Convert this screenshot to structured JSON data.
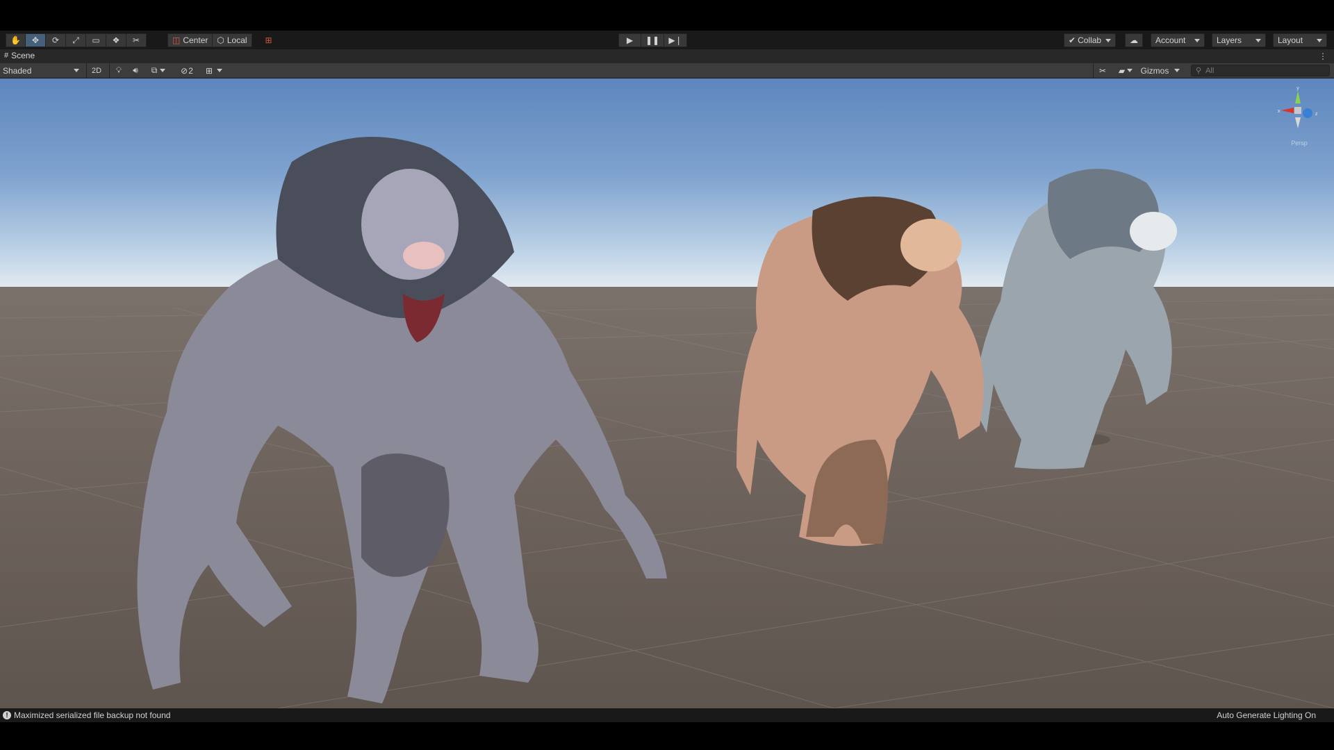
{
  "toolbar": {
    "tools": [
      {
        "icon": "hand-tool-icon",
        "glyph": "✋"
      },
      {
        "icon": "move-tool-icon",
        "glyph": "✥"
      },
      {
        "icon": "rotate-tool-icon",
        "glyph": "⟳"
      },
      {
        "icon": "scale-tool-icon",
        "glyph": "⤢"
      },
      {
        "icon": "rect-tool-icon",
        "glyph": "▭"
      },
      {
        "icon": "transform-tool-icon",
        "glyph": "❖"
      },
      {
        "icon": "custom-tool-icon",
        "glyph": "✂"
      }
    ],
    "pivot_label": "Center",
    "space_label": "Local",
    "collab_label": "Collab",
    "account_label": "Account",
    "layers_label": "Layers",
    "layout_label": "Layout"
  },
  "scene_tab": {
    "title": "Scene"
  },
  "scene_toolbar": {
    "shading_mode": "Shaded",
    "mode_2d": "2D",
    "hidden_count": "2",
    "gizmos_label": "Gizmos",
    "search_placeholder": "All"
  },
  "orientation_gizmo": {
    "x": "x",
    "y": "y",
    "z": "z",
    "projection": "Persp"
  },
  "status": {
    "message": "Maximized serialized file backup not found",
    "lighting": "Auto Generate Lighting On"
  },
  "colors": {
    "active_tool": "#46607c",
    "sky_top": "#5e86bd",
    "ground": "#6f655e"
  }
}
